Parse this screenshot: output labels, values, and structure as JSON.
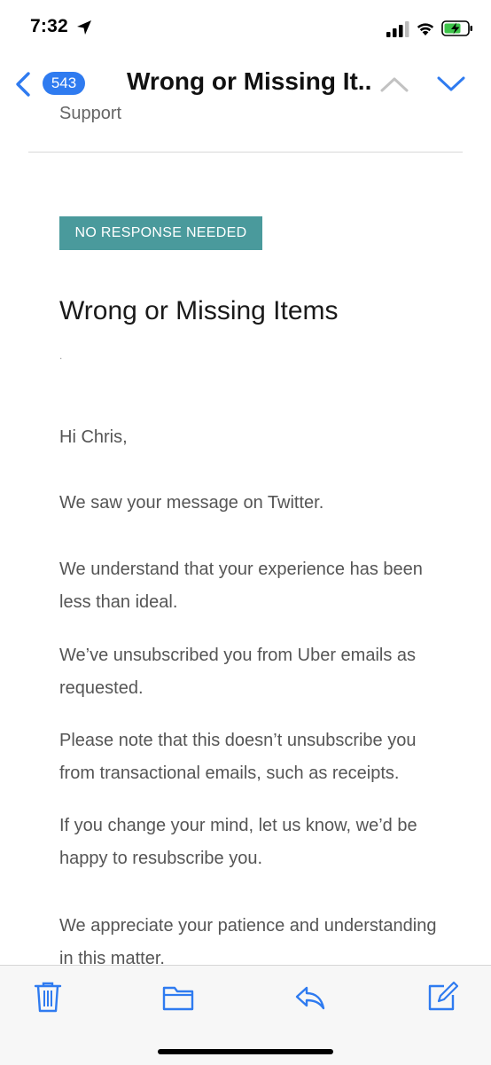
{
  "status_bar": {
    "time": "7:32"
  },
  "nav": {
    "unread_count": "543",
    "title": "Wrong or Missing It..."
  },
  "email": {
    "sender_label": "Support",
    "tag": "NO RESPONSE NEEDED",
    "subject": "Wrong or Missing Items",
    "separator": ".",
    "paragraphs": [
      "Hi Chris,",
      "We saw your message on Twitter.",
      "We understand that your experience has been less than ideal.",
      "We’ve unsubscribed you from Uber emails as requested.",
      "Please note that this doesn’t unsubscribe you from transactional emails, such as receipts.",
      "If you change your mind, let us know, we’d be happy to resubscribe you.",
      "We appreciate your patience and understanding in this matter."
    ]
  },
  "colors": {
    "accent": "#2f7bf0",
    "tag_bg": "#4a9a9c"
  },
  "toolbar_icons": [
    "trash-icon",
    "folder-icon",
    "reply-icon",
    "compose-icon"
  ]
}
